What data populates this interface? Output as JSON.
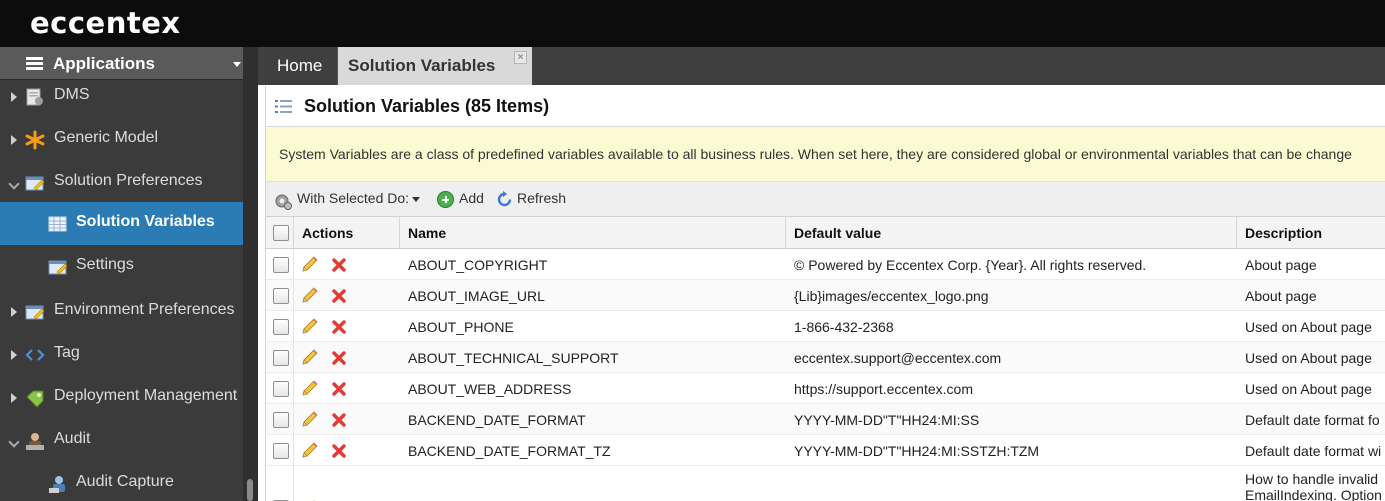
{
  "brand": {
    "logo_text": "eccentex"
  },
  "sidebar": {
    "header_title": "Applications",
    "items": [
      {
        "label": "DMS",
        "icon": "dms-icon",
        "level": 0,
        "expanded": false
      },
      {
        "label": "Generic Model",
        "icon": "generic-model-icon",
        "level": 0,
        "expanded": false
      },
      {
        "label": "Solution Preferences",
        "icon": "preferences-icon",
        "level": 0,
        "expanded": true
      },
      {
        "label": "Solution Variables",
        "icon": "table-icon",
        "level": 1,
        "active": true
      },
      {
        "label": "Settings",
        "icon": "settings-icon",
        "level": 1
      },
      {
        "label": "Environment Preferences",
        "icon": "preferences-icon",
        "level": 0,
        "expanded": false
      },
      {
        "label": "Tag",
        "icon": "tag-code-icon",
        "level": 0,
        "expanded": false
      },
      {
        "label": "Deployment Management",
        "icon": "deployment-icon",
        "level": 0,
        "expanded": false
      },
      {
        "label": "Audit",
        "icon": "audit-icon",
        "level": 0,
        "expanded": true
      },
      {
        "label": "Audit Capture",
        "icon": "audit-capture-icon",
        "level": 1
      }
    ]
  },
  "tabs": [
    {
      "label": "Home",
      "active": false
    },
    {
      "label": "Solution Variables",
      "active": true,
      "close_label": "×"
    }
  ],
  "panel": {
    "title": "Solution Variables (85 Items)",
    "info": "System Variables are a class of predefined variables available to all business rules. When set here, they are considered global or environmental variables that can be change"
  },
  "toolbar": {
    "with_selected": "With Selected Do:",
    "add": "Add",
    "refresh": "Refresh"
  },
  "grid": {
    "columns": [
      "Actions",
      "Name",
      "Default value",
      "Description"
    ],
    "rows": [
      {
        "name": "ABOUT_COPYRIGHT",
        "default_value": "© Powered by Eccentex Corp. {Year}. All rights reserved.",
        "description": "About page"
      },
      {
        "name": "ABOUT_IMAGE_URL",
        "default_value": "{Lib}images/eccentex_logo.png",
        "description": "About page"
      },
      {
        "name": "ABOUT_PHONE",
        "default_value": "1-866-432-2368",
        "description": "Used on About page"
      },
      {
        "name": "ABOUT_TECHNICAL_SUPPORT",
        "default_value": "eccentex.support@eccentex.com",
        "description": "Used on About page"
      },
      {
        "name": "ABOUT_WEB_ADDRESS",
        "default_value": "https://support.eccentex.com",
        "description": "Used on About page"
      },
      {
        "name": "BACKEND_DATE_FORMAT",
        "default_value": "YYYY-MM-DD\"T\"HH24:MI:SS",
        "description": "Default date format fo"
      },
      {
        "name": "BACKEND_DATE_FORMAT_TZ",
        "default_value": "YYYY-MM-DD\"T\"HH24:MI:SSTZH:TZM",
        "description": "Default date format wi"
      }
    ],
    "partial_row": {
      "description_line1": "How to handle invalid",
      "description_line2": "EmailIndexing. Option"
    }
  },
  "colors": {
    "topbar": "#0c0c0c",
    "sidebar": "#3b3b3b",
    "active_item": "#2b7bb5",
    "info_bg": "#fbfbd3",
    "delete_red": "#e53935",
    "add_green": "#4caf50"
  }
}
